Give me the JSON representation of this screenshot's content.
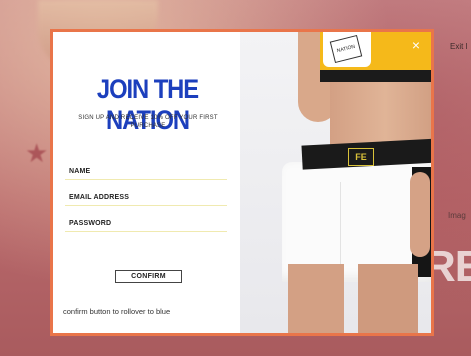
{
  "background": {
    "exit_label": "Exit l",
    "image_label": "Imag",
    "big_text": "RE"
  },
  "modal": {
    "title": "JOIN THE NATION",
    "subtitle": "SIGN UP AND RECEIVE 10% OFF YOUR FIRST PURCHASE",
    "fields": {
      "name": {
        "label": "NAME",
        "value": ""
      },
      "email": {
        "label": "EMAIL ADDRESS",
        "value": ""
      },
      "password": {
        "label": "PASSWORD",
        "value": ""
      }
    },
    "confirm_label": "CONFIRM",
    "note": "confirm button to rollover to blue",
    "close_icon": "×",
    "photo": {
      "bra_logo_text": "NATION",
      "waist_logo_text": "FE"
    }
  },
  "colors": {
    "title": "#1c3fbd",
    "modal_border": "#e9754a",
    "field_line": "#f0eab0",
    "bra_yellow": "#f5b91a"
  }
}
